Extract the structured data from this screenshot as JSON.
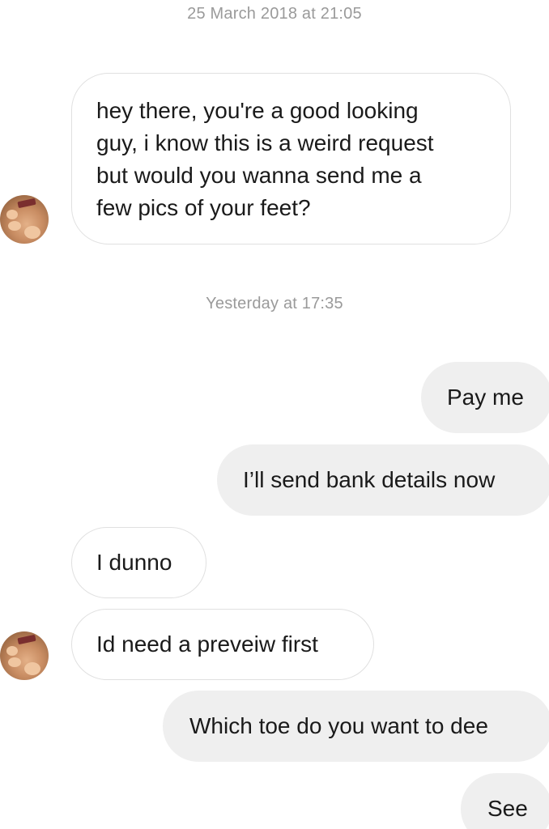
{
  "timestamps": {
    "first": "25 March 2018 at 21:05",
    "second": "Yesterday at 17:35"
  },
  "messages": [
    {
      "direction": "incoming",
      "lines": [
        "hey there, you're a good looking",
        "guy, i know this is a weird request",
        "but would you wanna send me a",
        "few pics of your feet?"
      ]
    },
    {
      "direction": "outgoing",
      "text": "Pay me"
    },
    {
      "direction": "outgoing",
      "text": "I’ll send bank details now"
    },
    {
      "direction": "incoming",
      "text": "I dunno"
    },
    {
      "direction": "incoming",
      "text": "Id need a preveiw first"
    },
    {
      "direction": "outgoing",
      "text": "Which toe do you want to dee"
    },
    {
      "direction": "outgoing",
      "text": "See"
    }
  ],
  "colors": {
    "background": "#ffffff",
    "outgoing_bubble": "#efefef",
    "incoming_border": "#e0e0e0",
    "timestamp_text": "#9a9a9a",
    "message_text": "#1a1a1a"
  },
  "icons": {
    "sender_avatar": "sender-avatar-feet-photo"
  }
}
